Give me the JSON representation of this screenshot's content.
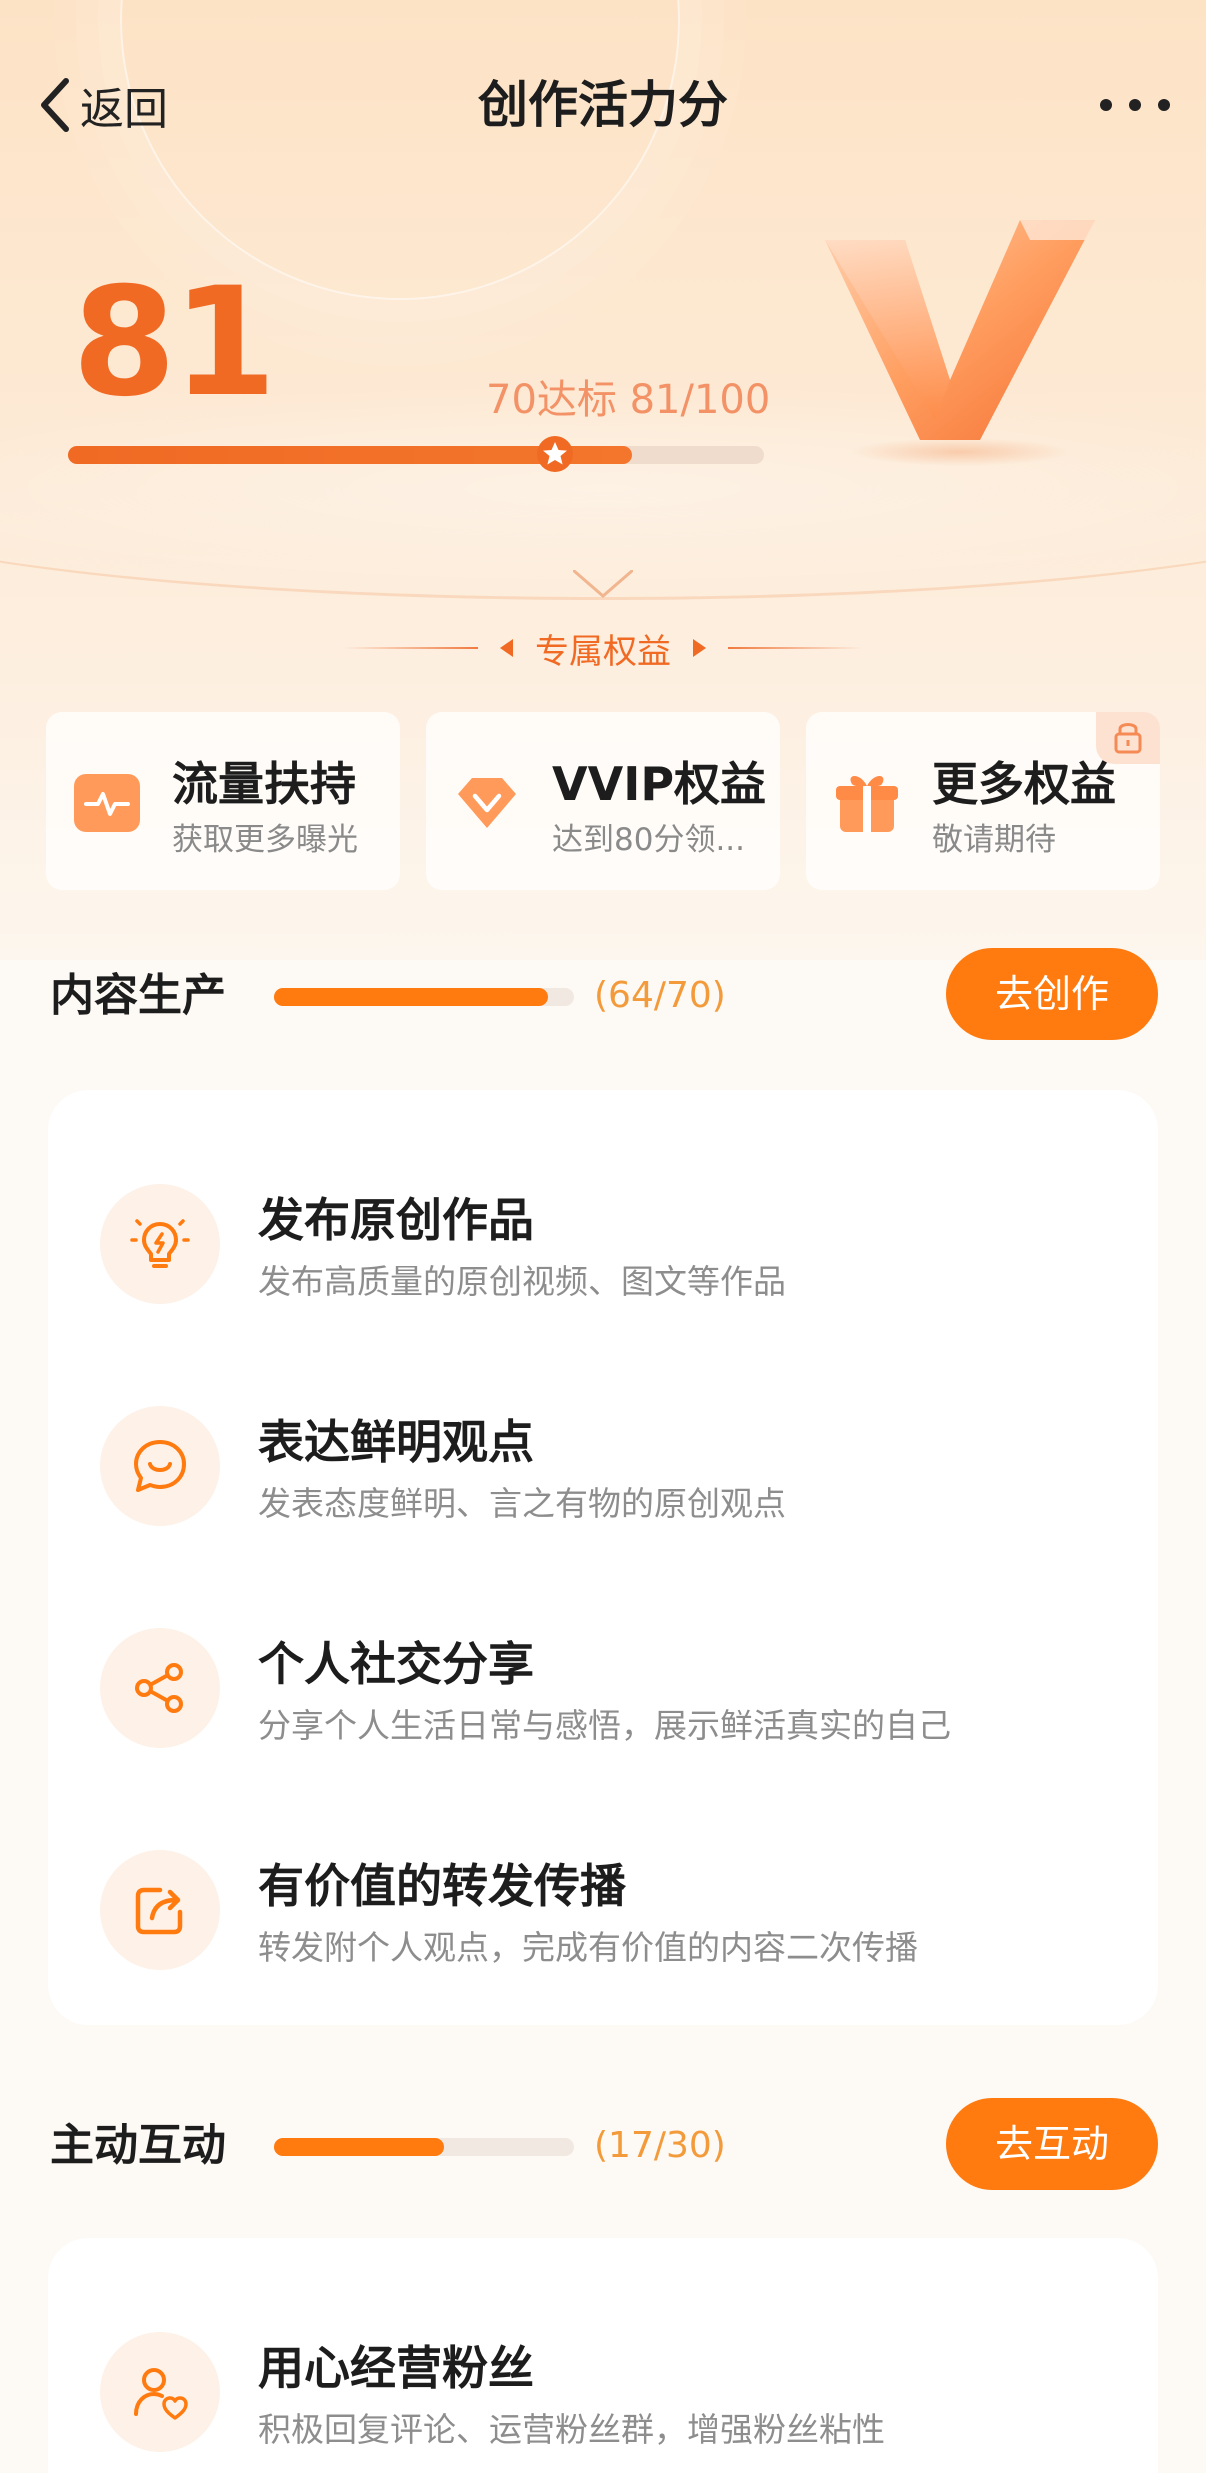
{
  "nav": {
    "back_label": "返回",
    "title": "创作活力分"
  },
  "score": {
    "value": "81",
    "meta": "70达标 81/100",
    "current": 81,
    "max": 100,
    "target": 70
  },
  "benefits": {
    "heading": "专属权益",
    "cards": [
      {
        "title": "流量扶持",
        "desc": "获取更多曝光",
        "icon": "traffic-icon"
      },
      {
        "title": "VVIP权益",
        "desc": "达到80分领...",
        "icon": "vvip-diamond-icon"
      },
      {
        "title": "更多权益",
        "desc": "敬请期待",
        "icon": "gift-icon",
        "locked": true
      }
    ]
  },
  "sections": [
    {
      "title": "内容生产",
      "count": "(64/70)",
      "current": 64,
      "max": 70,
      "button": "去创作",
      "items": [
        {
          "title": "发布原创作品",
          "desc": "发布高质量的原创视频、图文等作品",
          "icon": "lightbulb-icon"
        },
        {
          "title": "表达鲜明观点",
          "desc": "发表态度鲜明、言之有物的原创观点",
          "icon": "smile-bubble-icon"
        },
        {
          "title": "个人社交分享",
          "desc": "分享个人生活日常与感悟，展示鲜活真实的自己",
          "icon": "share-icon"
        },
        {
          "title": "有价值的转发传播",
          "desc": "转发附个人观点，完成有价值的内容二次传播",
          "icon": "forward-icon"
        }
      ]
    },
    {
      "title": "主动互动",
      "count": "(17/30)",
      "current": 17,
      "max": 30,
      "button": "去互动",
      "items": [
        {
          "title": "用心经营粉丝",
          "desc": "积极回复评论、运营粉丝群，增强粉丝粘性",
          "icon": "fan-heart-icon"
        }
      ]
    }
  ],
  "colors": {
    "accent": "#ff7a0f",
    "score": "#f06a24",
    "muted": "#8d8d8d"
  }
}
